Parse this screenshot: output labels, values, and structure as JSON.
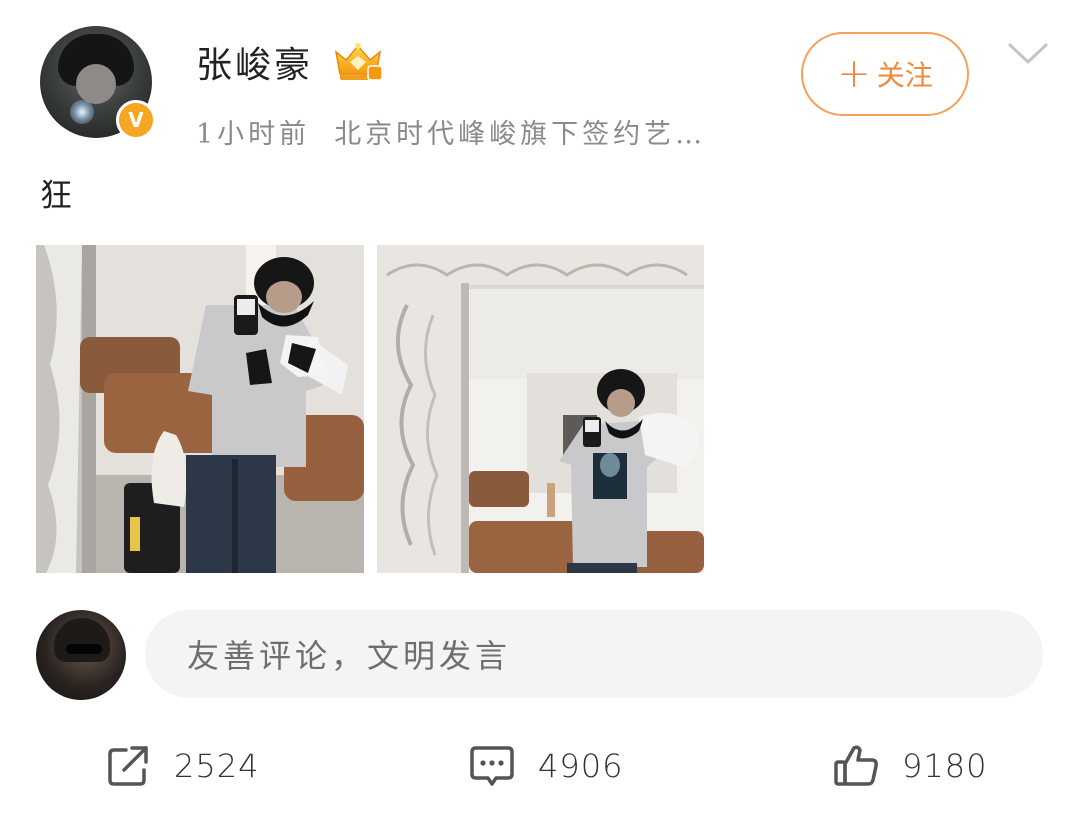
{
  "post": {
    "author": {
      "name": "张峻豪",
      "verified_icon": "v-badge-icon",
      "level_badge_icon": "crown-badge-icon",
      "verified_letter": "V"
    },
    "time": "1小时前",
    "source": "北京时代峰峻旗下签约艺…",
    "follow_button": {
      "plus": "+",
      "label": "关注"
    },
    "text": "狂",
    "images": [
      "mirror-selfie-1",
      "mirror-selfie-2"
    ]
  },
  "comment_box": {
    "placeholder": "友善评论，文明发言"
  },
  "actions": {
    "share": {
      "icon": "share-icon",
      "count": "2524"
    },
    "comment": {
      "icon": "comment-icon",
      "count": "4906"
    },
    "like": {
      "icon": "thumbs-up-icon",
      "count": "9180"
    }
  },
  "colors": {
    "accent": "#f08a3c",
    "verified": "#f5a623",
    "meta_text": "#8a8a8a",
    "input_bg": "#f4f4f4"
  }
}
